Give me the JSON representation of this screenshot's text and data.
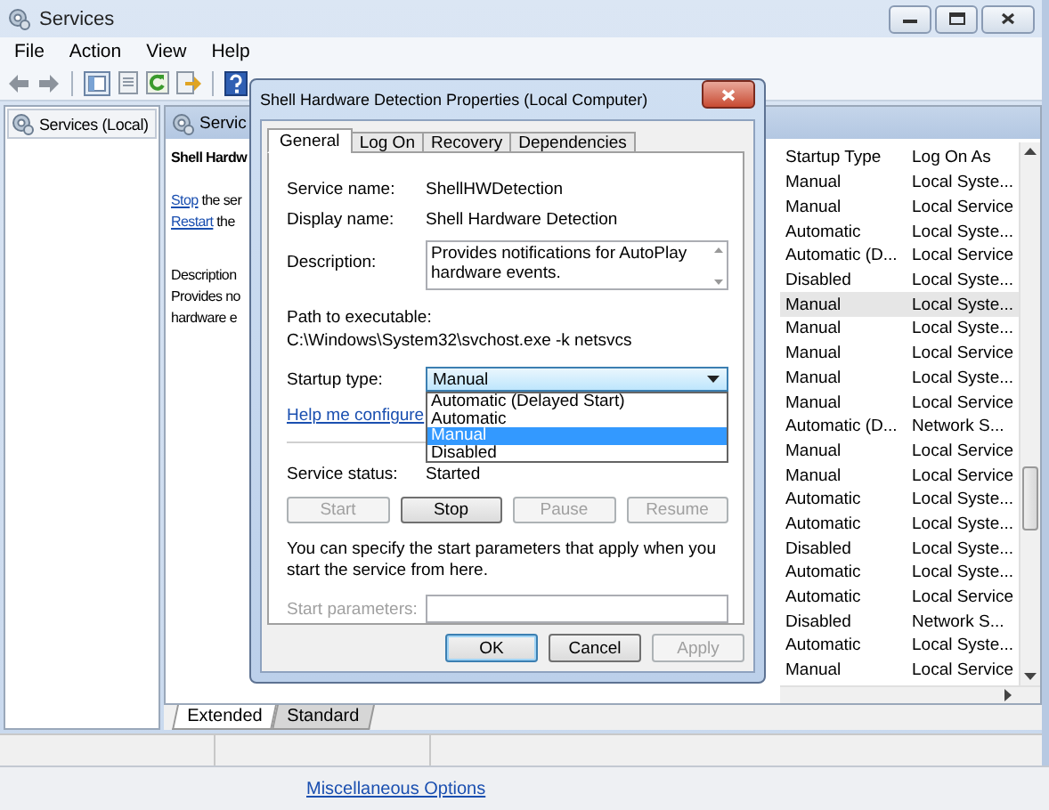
{
  "window": {
    "title": "Services"
  },
  "menu": [
    "File",
    "Action",
    "View",
    "Help"
  ],
  "tree": {
    "items": [
      {
        "label": "Services (Local)",
        "selected": true
      }
    ]
  },
  "pane": {
    "title": "Servic",
    "service_name": "Shell Hardw",
    "actions": [
      {
        "link": "Stop",
        "text": "the ser"
      },
      {
        "link": "Restart",
        "text": "the"
      }
    ],
    "description_label": "Description",
    "description_lines": [
      "Provides no",
      "hardware e"
    ]
  },
  "list": {
    "columns": [
      "Startup Type",
      "Log On As"
    ],
    "rows": [
      {
        "startup": "Manual",
        "log_on": "Local Syste...",
        "selected": false
      },
      {
        "startup": "Manual",
        "log_on": "Local Service",
        "selected": false
      },
      {
        "startup": "Automatic",
        "log_on": "Local Syste...",
        "selected": false
      },
      {
        "startup": "Automatic (D...",
        "log_on": "Local Service",
        "selected": false
      },
      {
        "startup": "Disabled",
        "log_on": "Local Syste...",
        "selected": false
      },
      {
        "startup": "Manual",
        "log_on": "Local Syste...",
        "selected": true
      },
      {
        "startup": "Manual",
        "log_on": "Local Syste...",
        "selected": false
      },
      {
        "startup": "Manual",
        "log_on": "Local Service",
        "selected": false
      },
      {
        "startup": "Manual",
        "log_on": "Local Syste...",
        "selected": false
      },
      {
        "startup": "Manual",
        "log_on": "Local Service",
        "selected": false
      },
      {
        "startup": "Automatic (D...",
        "log_on": "Network S...",
        "selected": false
      },
      {
        "startup": "Manual",
        "log_on": "Local Service",
        "selected": false
      },
      {
        "startup": "Manual",
        "log_on": "Local Service",
        "selected": false
      },
      {
        "startup": "Automatic",
        "log_on": "Local Syste...",
        "selected": false
      },
      {
        "startup": "Automatic",
        "log_on": "Local Syste...",
        "selected": false
      },
      {
        "startup": "Disabled",
        "log_on": "Local Syste...",
        "selected": false
      },
      {
        "startup": "Automatic",
        "log_on": "Local Syste...",
        "selected": false
      },
      {
        "startup": "Automatic",
        "log_on": "Local Service",
        "selected": false
      },
      {
        "startup": "Disabled",
        "log_on": "Network S...",
        "selected": false
      },
      {
        "startup": "Automatic",
        "log_on": "Local Syste...",
        "selected": false
      },
      {
        "startup": "Manual",
        "log_on": "Local Service",
        "selected": false
      }
    ]
  },
  "view_tabs": [
    {
      "label": "Extended",
      "selected": true
    },
    {
      "label": "Standard",
      "selected": false
    }
  ],
  "footer": {
    "link": "Miscellaneous Options"
  },
  "dialog": {
    "title": "Shell Hardware Detection Properties (Local Computer)",
    "tabs": [
      {
        "label": "General",
        "selected": true
      },
      {
        "label": "Log On",
        "selected": false
      },
      {
        "label": "Recovery",
        "selected": false
      },
      {
        "label": "Dependencies",
        "selected": false
      }
    ],
    "fields": [
      {
        "label": "Service name:",
        "value": "ShellHWDetection"
      },
      {
        "label": "Display name:",
        "value": "Shell Hardware Detection"
      }
    ],
    "description": {
      "label": "Description:",
      "value": "Provides notifications for AutoPlay hardware events."
    },
    "path": {
      "label": "Path to executable:",
      "value": "C:\\Windows\\System32\\svchost.exe -k netsvcs"
    },
    "startup_type": {
      "label": "Startup type:",
      "value": "Manual",
      "expanded": true,
      "options": [
        {
          "label": "Automatic (Delayed Start)",
          "selected": false
        },
        {
          "label": "Automatic",
          "selected": false
        },
        {
          "label": "Manual",
          "selected": true
        },
        {
          "label": "Disabled",
          "selected": false
        }
      ]
    },
    "help_link": "Help me configure",
    "status": {
      "label": "Service status:",
      "value": "Started"
    },
    "control_buttons": [
      {
        "label": "Start",
        "disabled": true
      },
      {
        "label": "Stop",
        "disabled": false
      },
      {
        "label": "Pause",
        "disabled": true
      },
      {
        "label": "Resume",
        "disabled": true
      }
    ],
    "note": "You can specify the start parameters that apply when you start the service from here.",
    "start_parameters": {
      "label": "Start parameters:",
      "disabled": true
    },
    "buttons": [
      {
        "label": "OK",
        "default": true,
        "disabled": false
      },
      {
        "label": "Cancel",
        "default": false,
        "disabled": false
      },
      {
        "label": "Apply",
        "default": false,
        "disabled": true
      }
    ]
  }
}
